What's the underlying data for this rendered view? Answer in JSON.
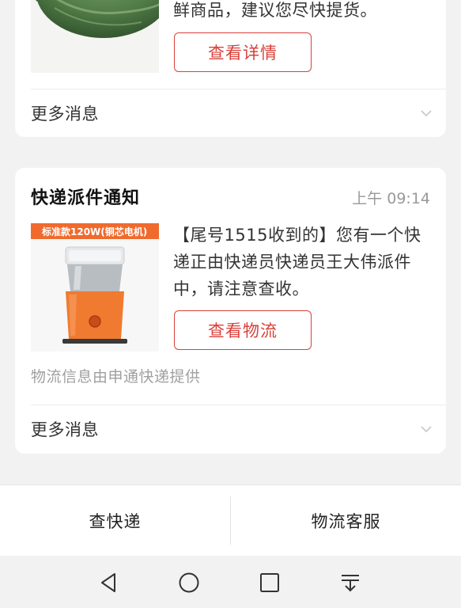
{
  "cards": [
    {
      "message": "鲜商品，建议您尽快提货。",
      "action_label": "查看详情",
      "more_label": "更多消息"
    },
    {
      "title": "快递派件通知",
      "time": "上午 09:14",
      "product_banner": "标准款120W(铜芯电机)",
      "message": "【尾号1515收到的】您有一个快递正由快递员快递员王大伟派件中，请注意查收。",
      "action_label": "查看物流",
      "provider_note": "物流信息由申通快递提供",
      "more_label": "更多消息"
    }
  ],
  "bottom_bar": {
    "left_label": "查快递",
    "right_label": "物流客服"
  },
  "nav": [
    "back-icon",
    "home-icon",
    "recents-icon",
    "notification-pull-icon"
  ],
  "colors": {
    "accent": "#d9413a",
    "banner": "#f06a2d"
  }
}
